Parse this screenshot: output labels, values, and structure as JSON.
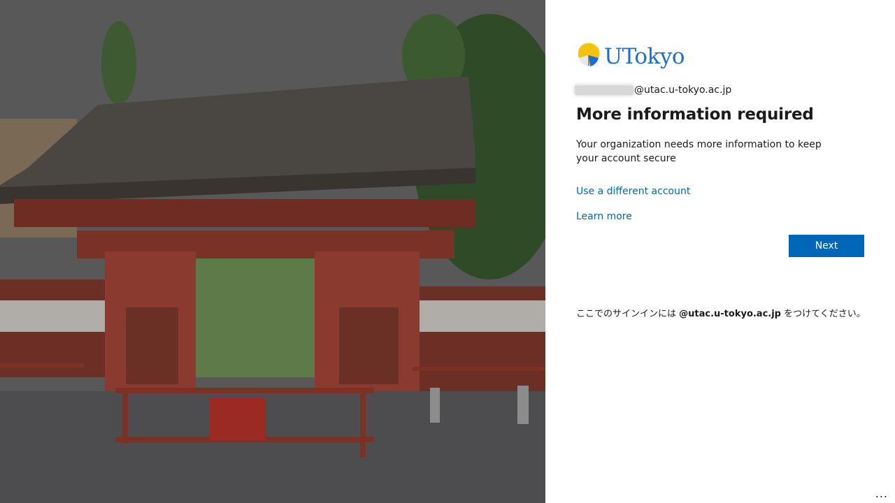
{
  "brand": {
    "logo_text": "UTokyo",
    "logo_color": "#1a6fd1",
    "emblem_color": "#f4c20d"
  },
  "account": {
    "email_domain": "@utac.u-tokyo.ac.jp"
  },
  "content": {
    "title": "More information required",
    "description": "Your organization needs more information to keep your account secure",
    "link_different_account": "Use a different account",
    "link_learn_more": "Learn more",
    "next_label": "Next"
  },
  "notice": {
    "prefix": "ここでのサインインには ",
    "domain": "@utac.u-tokyo.ac.jp",
    "suffix": " をつけてください。"
  },
  "footer": {
    "more_options": "..."
  },
  "colors": {
    "accent": "#0067b8",
    "text": "#1b1b1b",
    "gate_red": "#8a3a2e"
  }
}
